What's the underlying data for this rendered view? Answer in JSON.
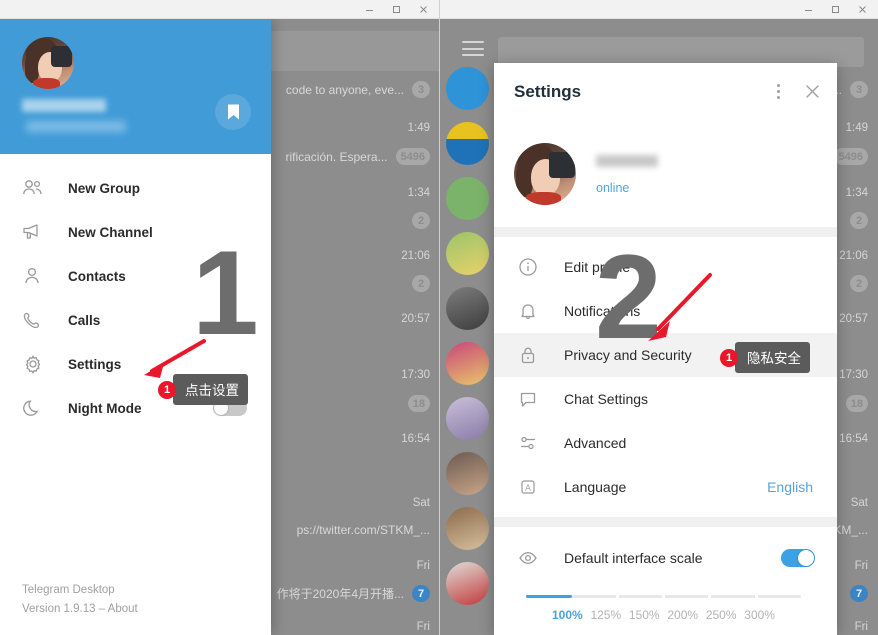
{
  "window_left": {
    "controls": {
      "minimize": "minimize-icon",
      "maximize": "maximize-icon",
      "close": "close-icon"
    },
    "menu": {
      "header": {
        "avatar": "user-avatar",
        "bookmark_icon": "bookmark-icon"
      },
      "items": [
        {
          "icon": "group-icon",
          "label": "New Group"
        },
        {
          "icon": "megaphone-icon",
          "label": "New Channel"
        },
        {
          "icon": "person-icon",
          "label": "Contacts"
        },
        {
          "icon": "phone-icon",
          "label": "Calls"
        },
        {
          "icon": "gear-icon",
          "label": "Settings"
        },
        {
          "icon": "moon-icon",
          "label": "Night Mode",
          "toggle": "off"
        }
      ],
      "app_name": "Telegram Desktop",
      "version_line": "Version 1.9.13 – About"
    },
    "step_number": "1",
    "annotation": {
      "number": "1",
      "text": "点击设置"
    },
    "chat_list": [
      {
        "snippet": "code to anyone, eve...",
        "badge": "3",
        "badge_type": "grey"
      },
      {
        "time": "1:49"
      },
      {
        "snippet": "rificación. Espera...",
        "badge": "5496",
        "badge_type": "grey"
      },
      {
        "time": "1:34"
      },
      {
        "badge": "2",
        "badge_type": "grey"
      },
      {
        "time": "21:06"
      },
      {
        "badge": "2",
        "badge_type": "grey"
      },
      {
        "time": "20:57"
      },
      {
        "time": "17:30"
      },
      {
        "badge": "18",
        "badge_type": "grey"
      },
      {
        "time": "16:54"
      },
      {
        "time": "Sat"
      },
      {
        "snippet": "ps://twitter.com/STKM_..."
      },
      {
        "time": "Fri"
      },
      {
        "snippet": "作将于2020年4月开播...",
        "badge": "7",
        "badge_type": "blue"
      },
      {
        "time": "Fri"
      }
    ]
  },
  "window_right": {
    "controls": {
      "minimize": "minimize-icon",
      "maximize": "maximize-icon",
      "close": "close-icon"
    },
    "hamburger": "menu-icon",
    "settings": {
      "title": "Settings",
      "menu_icon": "more-vertical-icon",
      "close_icon": "close-icon",
      "profile": {
        "avatar": "user-avatar",
        "status": "online"
      },
      "rows": [
        {
          "icon": "info-icon",
          "label": "Edit profile",
          "value": ""
        },
        {
          "icon": "bell-icon",
          "label": "Notifications",
          "value": ""
        },
        {
          "icon": "lock-icon",
          "label": "Privacy and Security",
          "value": "",
          "active": true
        },
        {
          "icon": "chat-icon",
          "label": "Chat Settings",
          "value": ""
        },
        {
          "icon": "sliders-icon",
          "label": "Advanced",
          "value": ""
        },
        {
          "icon": "language-icon",
          "label": "Language",
          "value": "English"
        }
      ],
      "scale": {
        "icon": "eye-icon",
        "label": "Default interface scale",
        "toggle": "on",
        "options": [
          "100%",
          "125%",
          "150%",
          "200%",
          "250%",
          "300%"
        ],
        "selected": "100%"
      }
    },
    "step_number": "2",
    "annotation": {
      "number": "1",
      "text": "隐私安全"
    },
    "chat_list": [
      {
        "snippet": "a...",
        "badge": "3",
        "badge_type": "grey"
      },
      {
        "time": "1:49"
      },
      {
        "badge": "5496",
        "badge_type": "grey"
      },
      {
        "time": "1:34"
      },
      {
        "badge": "2",
        "badge_type": "grey"
      },
      {
        "time": "21:06"
      },
      {
        "badge": "2",
        "badge_type": "grey"
      },
      {
        "time": "20:57"
      },
      {
        "time": "17:30"
      },
      {
        "badge": "18",
        "badge_type": "grey"
      },
      {
        "time": "16:54"
      },
      {
        "time": "Sat"
      },
      {
        "snippet": "KM_..."
      },
      {
        "time": "Fri"
      },
      {
        "badge": "7",
        "badge_type": "blue"
      },
      {
        "time": "Fri"
      }
    ]
  },
  "colors": {
    "brand_blue": "#409bd7",
    "accent_blue": "#3da1e5",
    "annotation_red": "#e8182a",
    "tooltip_grey": "#5b5b5b",
    "dim_grey": "#8d8d8d"
  }
}
